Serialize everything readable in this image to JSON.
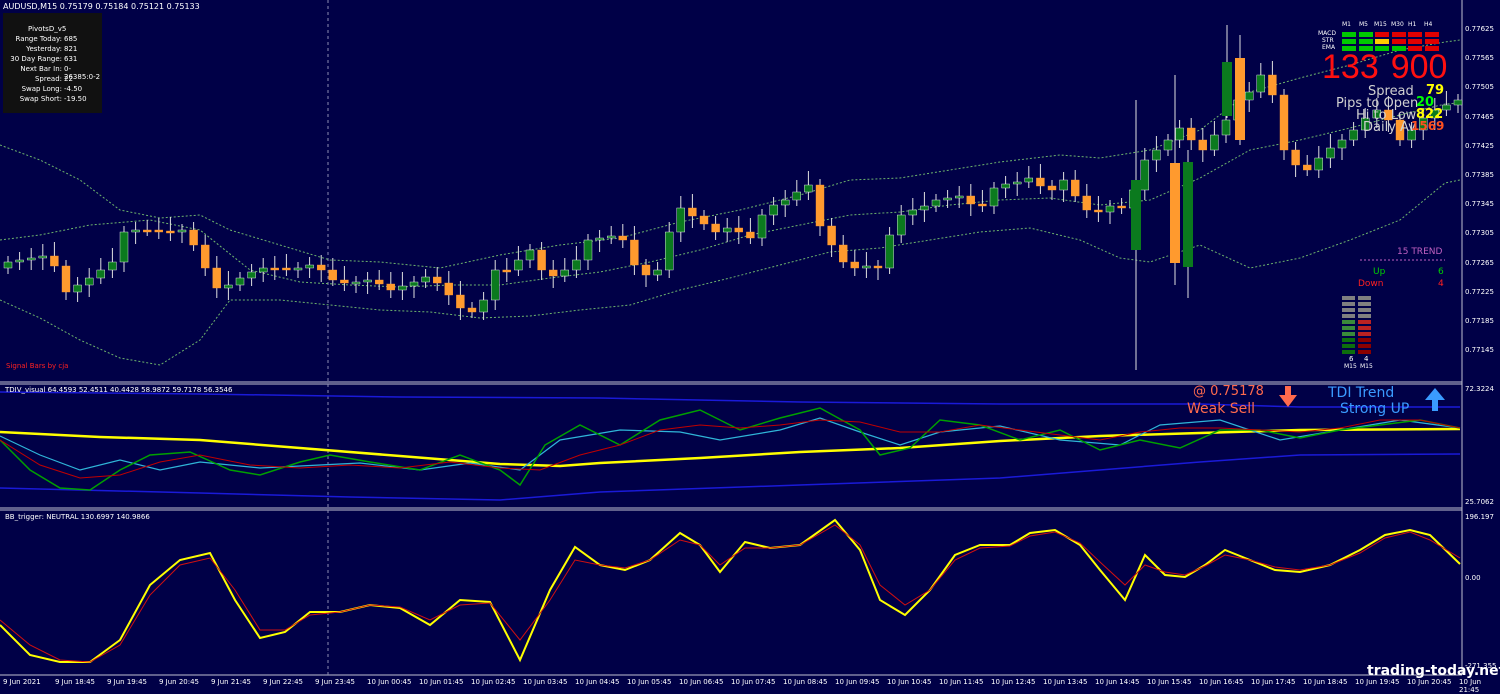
{
  "main_panel": {
    "title": "AUDUSD,M15  0.75179 0.75184 0.75121 0.75133",
    "signal_label": "Signal Bars by cja",
    "y_ticks": [
      "0.77625",
      "0.77565",
      "0.77505",
      "0.77465",
      "0.77425",
      "0.77385",
      "0.77345",
      "0.77305",
      "0.77265",
      "0.77225",
      "0.77185",
      "0.77145"
    ]
  },
  "pivots": {
    "title": "PivotsD_v5",
    "rows": [
      {
        "label": "Range Today:",
        "value": "685"
      },
      {
        "label": "Yesterday:",
        "value": "821"
      },
      {
        "label": "30 Day Range:",
        "value": "631"
      },
      {
        "label": "Next Bar In:",
        "value": "0-26385:0-2"
      },
      {
        "label": "Spread:",
        "value": "22"
      },
      {
        "label": "Swap  Long:",
        "value": "-4.50"
      },
      {
        "label": "Swap  Short:",
        "value": "-19.50"
      }
    ]
  },
  "signal_matrix": {
    "columns": [
      "M1",
      "M5",
      "M15",
      "M30",
      "H1",
      "H4"
    ],
    "rows": [
      "MACD",
      "STR",
      "EMA"
    ],
    "colors": [
      [
        "#00c800",
        "#00c800",
        "#e00000",
        "#e00000",
        "#e00000",
        "#e00000"
      ],
      [
        "#00c800",
        "#00c800",
        "#ffcc00",
        "#e00000",
        "#e00000",
        "#e00000"
      ],
      [
        "#00c800",
        "#00c800",
        "#00c800",
        "#00c800",
        "#e00000",
        "#e00000"
      ]
    ]
  },
  "info": {
    "big_number": "133",
    "big_number2": "900",
    "spread_label": "Spread",
    "spread_value": "79",
    "pips_label": "Pips to Open",
    "pips_value": "20",
    "hilo_label": "Hi to Low",
    "hilo_value": "822",
    "daily_label": "Daily Av",
    "daily_value": "1569"
  },
  "trend": {
    "title": "15 TREND",
    "up_label": "Up",
    "up_value": "6",
    "down_label": "Down",
    "down_value": "4",
    "col1_value": "6",
    "col2_value": "4",
    "col1_label": "M15",
    "col2_label": "M15"
  },
  "tdi_panel": {
    "title": "TDIV_visual 64.4593 52.4511 40.4428 58.9872 59.7178 56.3546",
    "price_label": "@ 0.75178",
    "signal_label": "Weak Sell",
    "trend_label": "TDI Trend",
    "trend_value": "Strong UP",
    "y_top": "72.3224",
    "y_bottom": "25.7062"
  },
  "bb_panel": {
    "title": "BB_trigger: NEUTRAL 130.6997 140.9866",
    "y_top": "196.197",
    "y_mid": "0.00",
    "y_bottom": "-271.355"
  },
  "x_ticks": [
    "9 Jun 2021",
    "9 Jun 18:45",
    "9 Jun 19:45",
    "9 Jun 20:45",
    "9 Jun 21:45",
    "9 Jun 22:45",
    "9 Jun 23:45",
    "10 Jun 00:45",
    "10 Jun 01:45",
    "10 Jun 02:45",
    "10 Jun 03:45",
    "10 Jun 04:45",
    "10 Jun 05:45",
    "10 Jun 06:45",
    "10 Jun 07:45",
    "10 Jun 08:45",
    "10 Jun 09:45",
    "10 Jun 10:45",
    "10 Jun 11:45",
    "10 Jun 12:45",
    "10 Jun 13:45",
    "10 Jun 14:45",
    "10 Jun 15:45",
    "10 Jun 16:45",
    "10 Jun 17:45",
    "10 Jun 18:45",
    "10 Jun 19:45",
    "10 Jun 20:45",
    "10 Jun 21:45"
  ],
  "watermark": "trading-today.net",
  "colors": {
    "background": "#000047",
    "bull": "#0b7a1e",
    "bear": "#ff9a2e",
    "band": "#6db36d",
    "tdi_yellow": "#ffff00",
    "tdi_green": "#00a000",
    "tdi_red": "#c00000",
    "tdi_cyan": "#2fb5d8",
    "tdi_blue": "#2222ff"
  },
  "chart_data": {
    "type": "candlestick",
    "candles_ohlc": [
      [
        0.7732,
        0.7734,
        0.7726,
        0.7731
      ],
      [
        0.7729,
        0.7732,
        0.7727,
        0.7731
      ],
      [
        0.7729,
        0.7731,
        0.7726,
        0.773
      ],
      [
        0.7729,
        0.7733,
        0.7726,
        0.7732
      ],
      [
        0.7732,
        0.7733,
        0.7728,
        0.7729
      ],
      [
        0.7729,
        0.773,
        0.7724,
        0.7725
      ],
      [
        0.7724,
        0.7726,
        0.7722,
        0.7725
      ],
      [
        0.7725,
        0.7727,
        0.7723,
        0.7726
      ],
      [
        0.7726,
        0.773,
        0.7725,
        0.7729
      ],
      [
        0.7729,
        0.7731,
        0.7727,
        0.773
      ],
      [
        0.773,
        0.7736,
        0.7729,
        0.7735
      ],
      [
        0.7735,
        0.7736,
        0.7734,
        0.7735
      ]
    ]
  }
}
